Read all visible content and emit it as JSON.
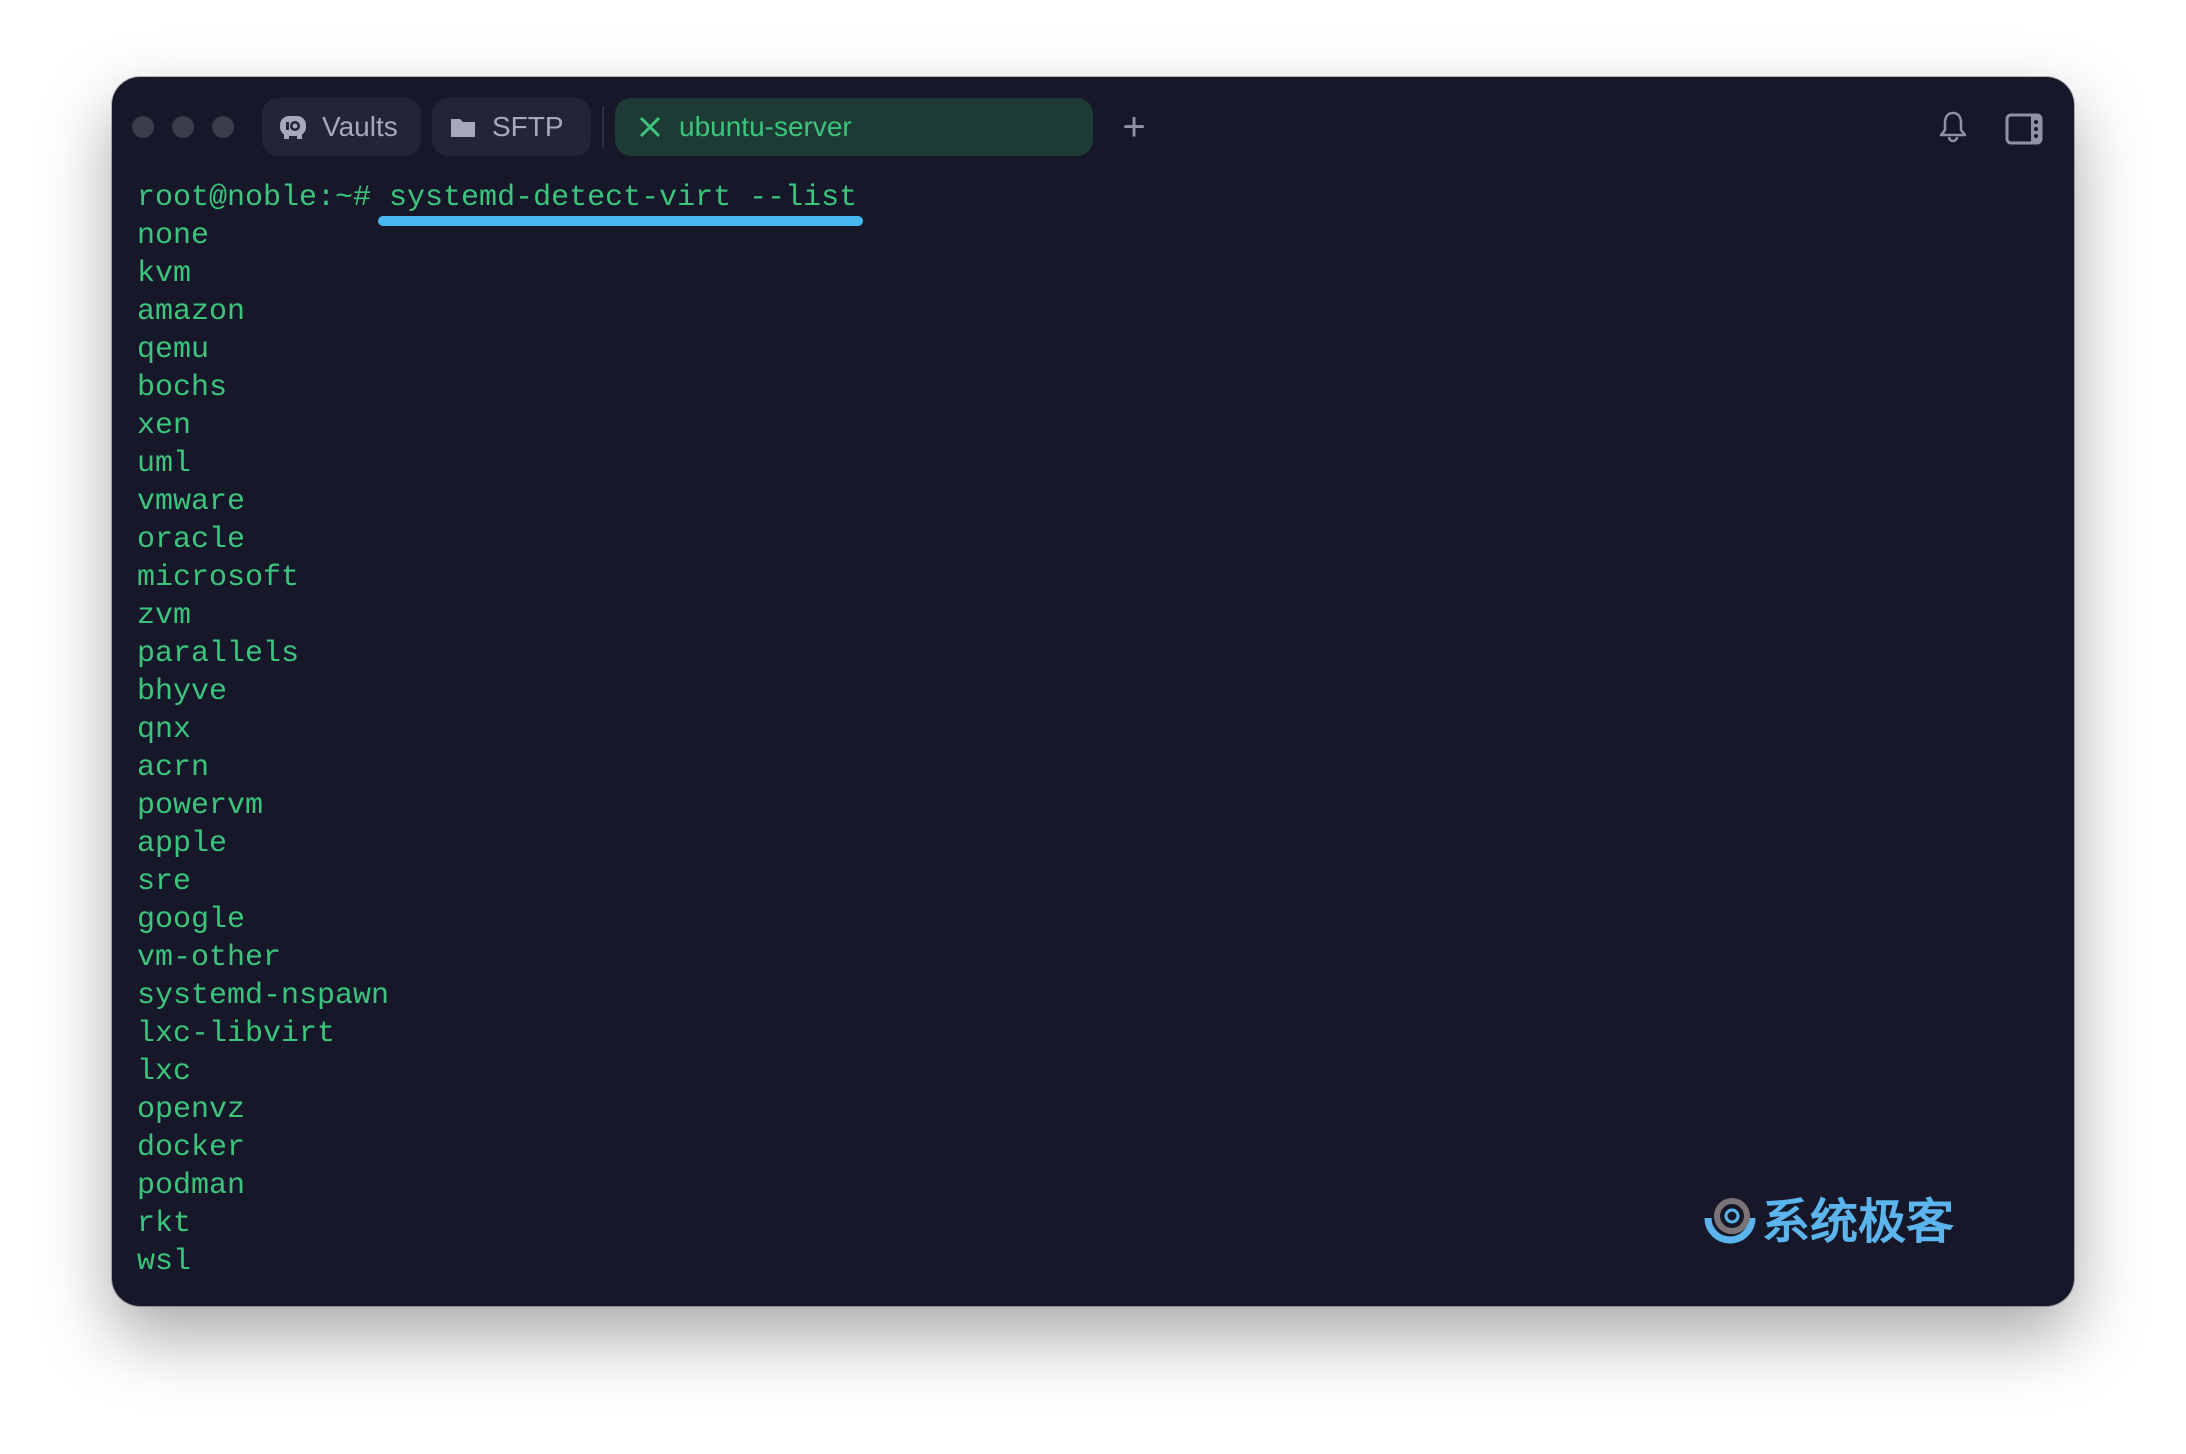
{
  "tabs": [
    {
      "label": "Vaults",
      "icon": "vault-icon"
    },
    {
      "label": "SFTP",
      "icon": "folder-icon"
    },
    {
      "label": "ubuntu-server",
      "icon": "close-icon",
      "active": true
    }
  ],
  "new_tab_label": "+",
  "terminal": {
    "prompt": "root@noble:~# ",
    "command": "systemd-detect-virt --list",
    "output": [
      "none",
      "kvm",
      "amazon",
      "qemu",
      "bochs",
      "xen",
      "uml",
      "vmware",
      "oracle",
      "microsoft",
      "zvm",
      "parallels",
      "bhyve",
      "qnx",
      "acrn",
      "powervm",
      "apple",
      "sre",
      "google",
      "vm-other",
      "systemd-nspawn",
      "lxc-libvirt",
      "lxc",
      "openvz",
      "docker",
      "podman",
      "rkt",
      "wsl"
    ]
  },
  "watermark": "系统极客",
  "colors": {
    "background": "#161829",
    "text": "#3cc47c",
    "highlight": "#4ab8f0",
    "active_tab": "#1d3a35"
  }
}
